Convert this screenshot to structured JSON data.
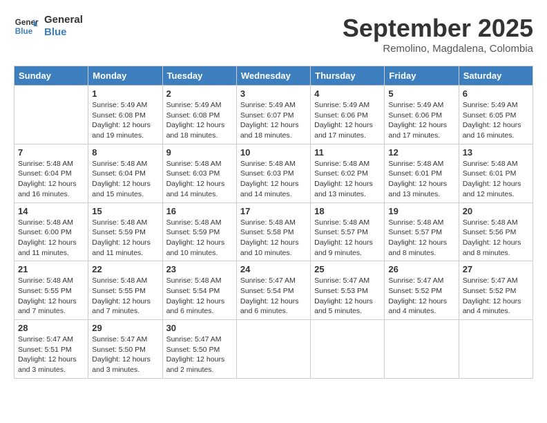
{
  "header": {
    "logo_line1": "General",
    "logo_line2": "Blue",
    "month_title": "September 2025",
    "subtitle": "Remolino, Magdalena, Colombia"
  },
  "weekdays": [
    "Sunday",
    "Monday",
    "Tuesday",
    "Wednesday",
    "Thursday",
    "Friday",
    "Saturday"
  ],
  "weeks": [
    [
      {
        "day": "",
        "info": ""
      },
      {
        "day": "1",
        "info": "Sunrise: 5:49 AM\nSunset: 6:08 PM\nDaylight: 12 hours\nand 19 minutes."
      },
      {
        "day": "2",
        "info": "Sunrise: 5:49 AM\nSunset: 6:08 PM\nDaylight: 12 hours\nand 18 minutes."
      },
      {
        "day": "3",
        "info": "Sunrise: 5:49 AM\nSunset: 6:07 PM\nDaylight: 12 hours\nand 18 minutes."
      },
      {
        "day": "4",
        "info": "Sunrise: 5:49 AM\nSunset: 6:06 PM\nDaylight: 12 hours\nand 17 minutes."
      },
      {
        "day": "5",
        "info": "Sunrise: 5:49 AM\nSunset: 6:06 PM\nDaylight: 12 hours\nand 17 minutes."
      },
      {
        "day": "6",
        "info": "Sunrise: 5:49 AM\nSunset: 6:05 PM\nDaylight: 12 hours\nand 16 minutes."
      }
    ],
    [
      {
        "day": "7",
        "info": "Sunrise: 5:48 AM\nSunset: 6:04 PM\nDaylight: 12 hours\nand 16 minutes."
      },
      {
        "day": "8",
        "info": "Sunrise: 5:48 AM\nSunset: 6:04 PM\nDaylight: 12 hours\nand 15 minutes."
      },
      {
        "day": "9",
        "info": "Sunrise: 5:48 AM\nSunset: 6:03 PM\nDaylight: 12 hours\nand 14 minutes."
      },
      {
        "day": "10",
        "info": "Sunrise: 5:48 AM\nSunset: 6:03 PM\nDaylight: 12 hours\nand 14 minutes."
      },
      {
        "day": "11",
        "info": "Sunrise: 5:48 AM\nSunset: 6:02 PM\nDaylight: 12 hours\nand 13 minutes."
      },
      {
        "day": "12",
        "info": "Sunrise: 5:48 AM\nSunset: 6:01 PM\nDaylight: 12 hours\nand 13 minutes."
      },
      {
        "day": "13",
        "info": "Sunrise: 5:48 AM\nSunset: 6:01 PM\nDaylight: 12 hours\nand 12 minutes."
      }
    ],
    [
      {
        "day": "14",
        "info": "Sunrise: 5:48 AM\nSunset: 6:00 PM\nDaylight: 12 hours\nand 11 minutes."
      },
      {
        "day": "15",
        "info": "Sunrise: 5:48 AM\nSunset: 5:59 PM\nDaylight: 12 hours\nand 11 minutes."
      },
      {
        "day": "16",
        "info": "Sunrise: 5:48 AM\nSunset: 5:59 PM\nDaylight: 12 hours\nand 10 minutes."
      },
      {
        "day": "17",
        "info": "Sunrise: 5:48 AM\nSunset: 5:58 PM\nDaylight: 12 hours\nand 10 minutes."
      },
      {
        "day": "18",
        "info": "Sunrise: 5:48 AM\nSunset: 5:57 PM\nDaylight: 12 hours\nand 9 minutes."
      },
      {
        "day": "19",
        "info": "Sunrise: 5:48 AM\nSunset: 5:57 PM\nDaylight: 12 hours\nand 8 minutes."
      },
      {
        "day": "20",
        "info": "Sunrise: 5:48 AM\nSunset: 5:56 PM\nDaylight: 12 hours\nand 8 minutes."
      }
    ],
    [
      {
        "day": "21",
        "info": "Sunrise: 5:48 AM\nSunset: 5:55 PM\nDaylight: 12 hours\nand 7 minutes."
      },
      {
        "day": "22",
        "info": "Sunrise: 5:48 AM\nSunset: 5:55 PM\nDaylight: 12 hours\nand 7 minutes."
      },
      {
        "day": "23",
        "info": "Sunrise: 5:48 AM\nSunset: 5:54 PM\nDaylight: 12 hours\nand 6 minutes."
      },
      {
        "day": "24",
        "info": "Sunrise: 5:47 AM\nSunset: 5:54 PM\nDaylight: 12 hours\nand 6 minutes."
      },
      {
        "day": "25",
        "info": "Sunrise: 5:47 AM\nSunset: 5:53 PM\nDaylight: 12 hours\nand 5 minutes."
      },
      {
        "day": "26",
        "info": "Sunrise: 5:47 AM\nSunset: 5:52 PM\nDaylight: 12 hours\nand 4 minutes."
      },
      {
        "day": "27",
        "info": "Sunrise: 5:47 AM\nSunset: 5:52 PM\nDaylight: 12 hours\nand 4 minutes."
      }
    ],
    [
      {
        "day": "28",
        "info": "Sunrise: 5:47 AM\nSunset: 5:51 PM\nDaylight: 12 hours\nand 3 minutes."
      },
      {
        "day": "29",
        "info": "Sunrise: 5:47 AM\nSunset: 5:50 PM\nDaylight: 12 hours\nand 3 minutes."
      },
      {
        "day": "30",
        "info": "Sunrise: 5:47 AM\nSunset: 5:50 PM\nDaylight: 12 hours\nand 2 minutes."
      },
      {
        "day": "",
        "info": ""
      },
      {
        "day": "",
        "info": ""
      },
      {
        "day": "",
        "info": ""
      },
      {
        "day": "",
        "info": ""
      }
    ]
  ]
}
